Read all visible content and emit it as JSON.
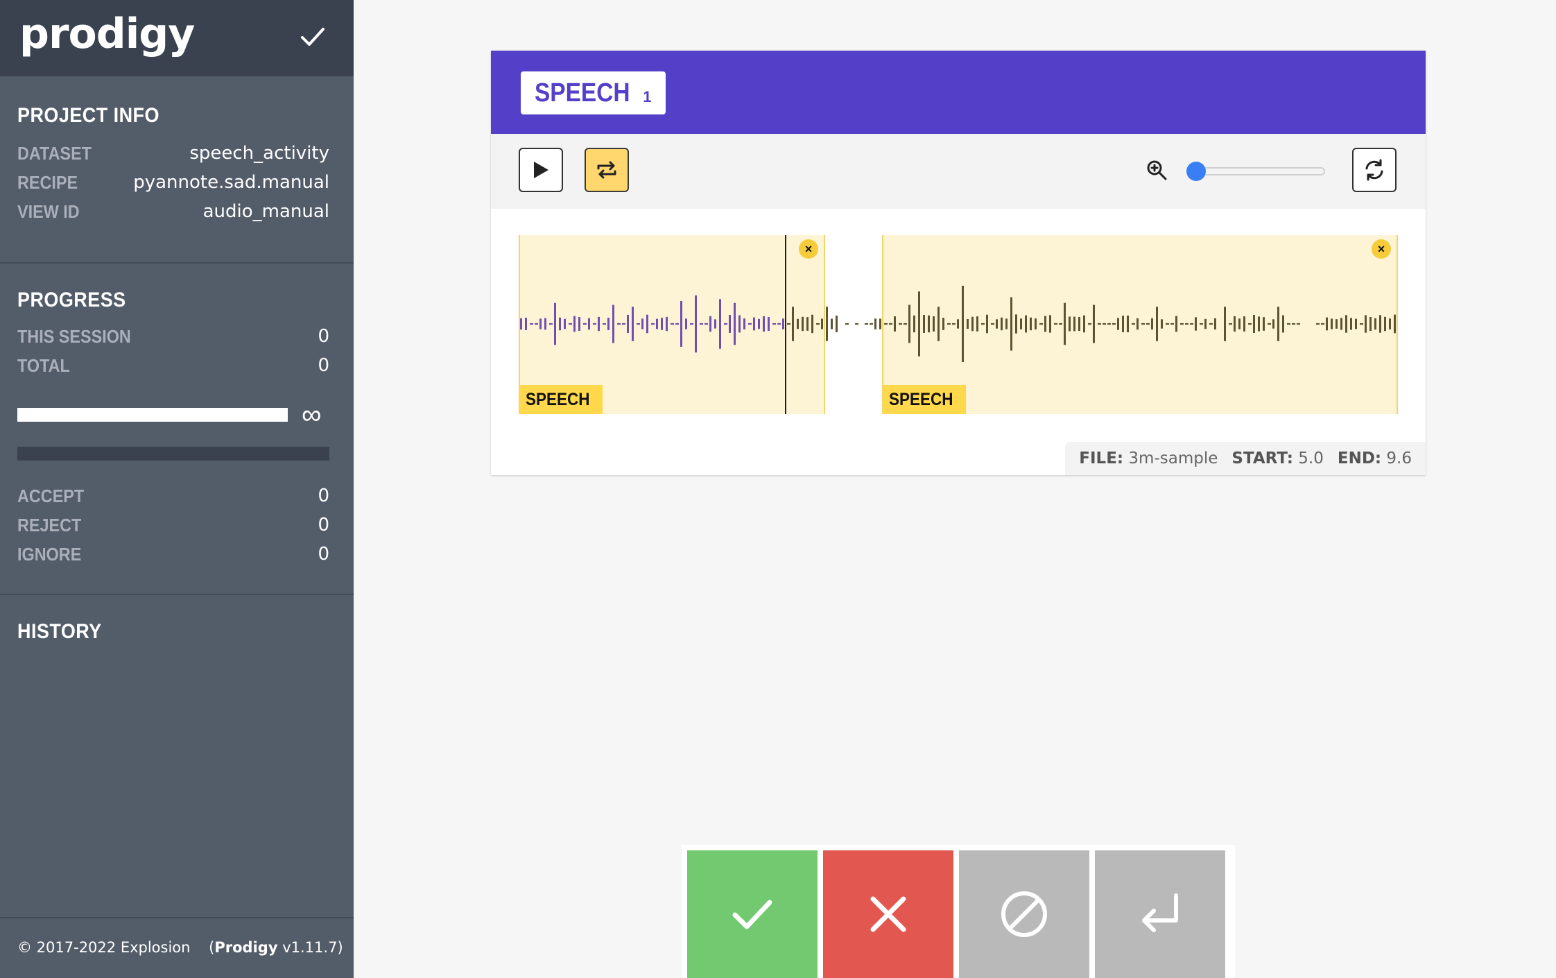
{
  "app": {
    "logo": "prodigy"
  },
  "project_info": {
    "title": "PROJECT INFO",
    "rows": [
      {
        "key": "DATASET",
        "value": "speech_activity"
      },
      {
        "key": "RECIPE",
        "value": "pyannote.sad.manual"
      },
      {
        "key": "VIEW ID",
        "value": "audio_manual"
      }
    ]
  },
  "progress": {
    "title": "PROGRESS",
    "session": {
      "key": "THIS SESSION",
      "value": "0"
    },
    "total": {
      "key": "TOTAL",
      "value": "0"
    },
    "infinity": "∞",
    "fraction": 1.0,
    "counts": [
      {
        "key": "ACCEPT",
        "value": "0"
      },
      {
        "key": "REJECT",
        "value": "0"
      },
      {
        "key": "IGNORE",
        "value": "0"
      }
    ]
  },
  "history": {
    "title": "HISTORY"
  },
  "footer": {
    "copyright": "© 2017-2022 Explosion",
    "product": "Prodigy",
    "version": "v1.11.7"
  },
  "card": {
    "label": {
      "name": "SPEECH",
      "shortcut": "1"
    },
    "zoom_level": 0.0,
    "regions": [
      {
        "label": "SPEECH",
        "close": "×"
      },
      {
        "label": "SPEECH",
        "close": "×"
      }
    ],
    "meta": [
      {
        "key": "FILE:",
        "value": "3m-sample"
      },
      {
        "key": "START:",
        "value": "5.0"
      },
      {
        "key": "END:",
        "value": "9.6"
      }
    ]
  },
  "colors": {
    "header": "#5440c8",
    "accept": "#72c96f",
    "reject": "#e2574f",
    "ignore": "#b9b9b9",
    "wave_played": "#6f4fb0",
    "wave_unplayed": "#5c5330"
  },
  "icons": {
    "play": "play-icon",
    "loop": "loop-icon",
    "zoom": "zoom-in-icon",
    "refresh": "refresh-icon"
  }
}
